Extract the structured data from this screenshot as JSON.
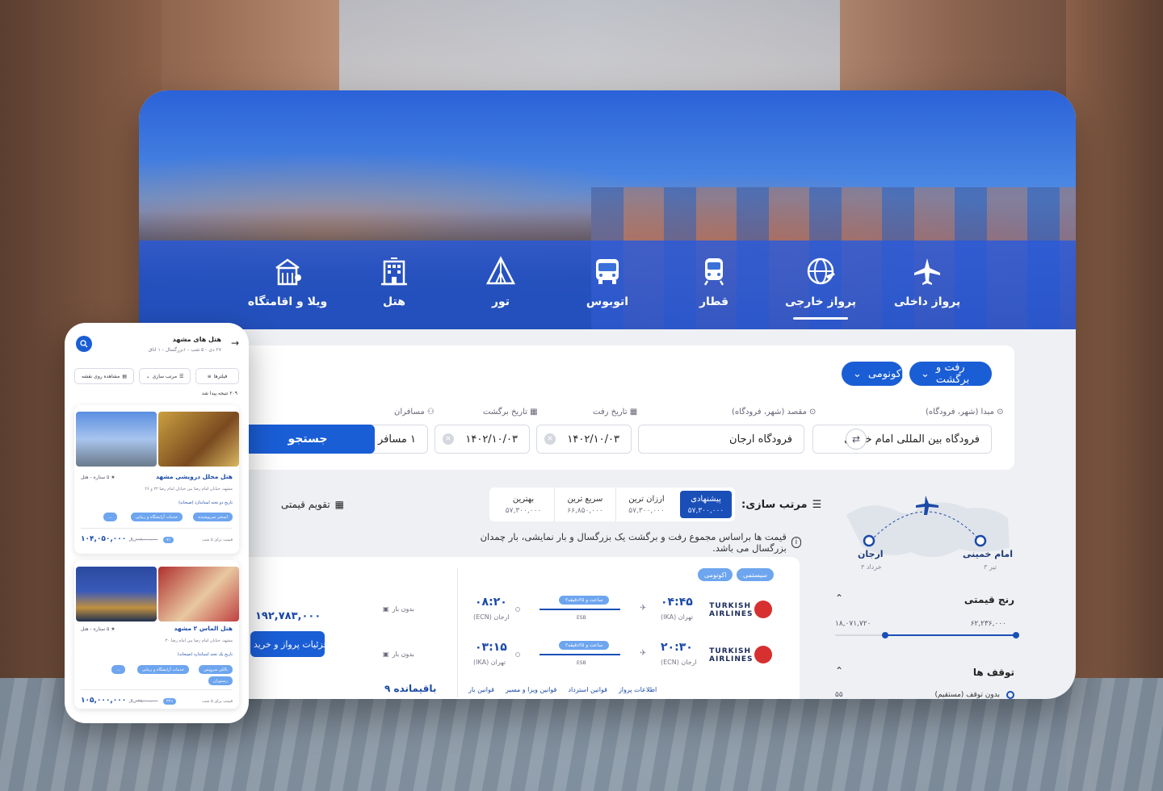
{
  "nav": {
    "items": [
      {
        "label": "پرواز داخلی",
        "icon": "airplane-icon"
      },
      {
        "label": "پرواز خارجی",
        "icon": "globe-plane-icon",
        "active": true
      },
      {
        "label": "قطار",
        "icon": "train-icon"
      },
      {
        "label": "اتوبوس",
        "icon": "bus-icon"
      },
      {
        "label": "تور",
        "icon": "tent-icon"
      },
      {
        "label": "هتل",
        "icon": "hotel-icon"
      },
      {
        "label": "ویلا و اقامتگاه",
        "icon": "villa-icon"
      }
    ]
  },
  "search": {
    "trip_type": "رفت و برگشت",
    "cabin": "اکونومی",
    "origin_label": "مبدا (شهر، فرودگاه)",
    "origin_value": "فرودگاه بین المللی امام خمینی",
    "dest_label": "مقصد (شهر، فرودگاه)",
    "dest_value": "فرودگاه ارجان",
    "depart_label": "تاریخ رفت",
    "depart_value": "۱۴۰۲/۱۰/۰۳",
    "return_label": "تاریخ برگشت",
    "return_value": "۱۴۰۲/۱۰/۰۳",
    "passengers_label": "مسافران",
    "passengers_value": "۱ مسافر",
    "submit": "جستجو"
  },
  "sort": {
    "label": "مرتب سازی:",
    "options": [
      {
        "name": "پیشنهادی",
        "value": "۵۷,۳۰۰,۰۰۰",
        "selected": true
      },
      {
        "name": "ارزان ترین",
        "value": "۵۷,۳۰۰,۰۰۰"
      },
      {
        "name": "سریع ترین",
        "value": "۶۶,۸۵۰,۰۰۰"
      },
      {
        "name": "بهترین",
        "value": "۵۷,۳۰۰,۰۰۰"
      }
    ],
    "price_calendar": "تقویم قیمتی"
  },
  "notice": "قیمت ها براساس مجموع رفت و برگشت یک بزرگسال و بار نمایشی، بار چمدان بزرگسال می باشد.",
  "map": {
    "origin_city": "امام خمینی",
    "origin_date": "۳ تیر",
    "dest_city": "ارجان",
    "dest_date": "۳ خرداد"
  },
  "filters": {
    "price_range_title": "رنج قیمتی",
    "price_min": "۱۸,۰۷۱,۷۲۰",
    "price_max": "۶۲,۲۳۶,۰۰۰",
    "stops_title": "توقف ها",
    "stops_first": "بدون توقف (مستقیم)",
    "stops_first_count": "۵۵"
  },
  "flight": {
    "tags": [
      "سیستمی",
      "اکونومی"
    ],
    "airline": "TURKISH AIRLINES",
    "outbound": {
      "dep_time": "۰۴:۴۵",
      "dep_ap": "تهران (IKA)",
      "arr_time": "۰۸:۲۰",
      "arr_ap": "ارجان (ECN)",
      "duration": "۲ساعت و ۲۵دقیقه",
      "hub": "ESB",
      "baggage": "بدون بار"
    },
    "inbound": {
      "dep_time": "۲۰:۳۰",
      "dep_ap": "ارجان (ECN)",
      "arr_time": "۰۳:۱۵",
      "arr_ap": "تهران (IKA)",
      "duration": "۲ساعت و ۲۵دقیقه",
      "hub": "ESB",
      "baggage": "بدون بار"
    },
    "links": [
      "اطلاعات پرواز",
      "قوانین استرداد",
      "قوانین ویزا و مسیر",
      "قوانین بار"
    ],
    "remaining": "۹ باقیمانده",
    "price": "۱۹۲,۷۸۳,۰۰۰",
    "details_button": "جزئیات پرواز و خرید"
  },
  "mobile": {
    "title": "هتل های مشهد",
    "subtitle": "۲۷ دی - ۵ شب - ۱بزرگسال - ۱ اتاق",
    "chips": [
      "فیلترها",
      "مرتب سازی",
      "مشاهده روی نقشه"
    ],
    "count": "۲۰۹ نتیجه پیدا شد",
    "hotels": [
      {
        "name": "هتل مجلل درویشی مشهد",
        "stars": "۵ ستاره - هتل",
        "address": "مشهد، خیابان امام رضا بین خیابان امام رضا ۲۴ و ۲۶",
        "policy": "تاریخ دو تخته استاندارد (صبحانه)",
        "badges": [
          "استخر سرپوشیده",
          "خدمات آرایشگاه و زیبایی",
          "..."
        ],
        "night_label": "قیمت برای ۵ شب",
        "discount": "۷٪",
        "old_price": "۱۱۲,۰۰۰,۰۰۰",
        "price": "۱۰۴,۰۵۰,۰۰۰",
        "currency": "ریال"
      },
      {
        "name": "هتل الماس ۲ مشهد",
        "stars": "۵ ستاره - هتل",
        "address": "مشهد، خیابان امام رضا بین امام رضا ۳۰",
        "policy": "تاریخ یک تخته استاندارد (صبحانه)",
        "badges": [
          "بالکن سرویس",
          "خدمات آرایشگاه و زیبایی",
          "...",
          "رستوران"
        ],
        "night_label": "قیمت برای ۵ شب",
        "discount": "۲۲٪",
        "old_price": "۱۳۵,۰۰۰,۰۰۰",
        "price": "۱۰۵,۰۰۰,۰۰۰",
        "currency": "ریال"
      }
    ]
  }
}
